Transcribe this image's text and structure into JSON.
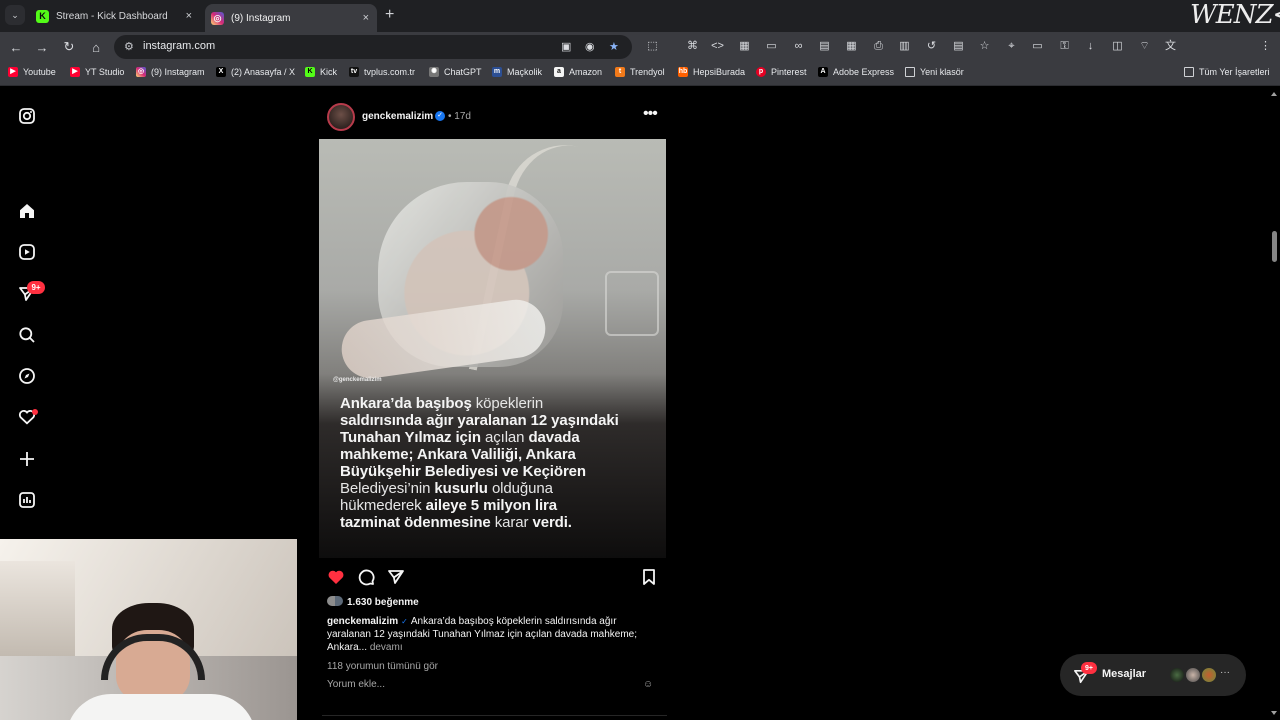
{
  "browser": {
    "tabs": [
      {
        "title": "Stream - Kick Dashboard",
        "icon": "kick-icon",
        "active": false
      },
      {
        "title": "(9) Instagram",
        "icon": "instagram-icon",
        "active": true
      }
    ],
    "tab_close": "×",
    "new_tab": "+",
    "url": "instagram.com",
    "overlay_text": "WENZ<LL",
    "bookmarks": [
      {
        "label": "Youtube",
        "icon": "youtube-icon"
      },
      {
        "label": "YT Studio",
        "icon": "youtube-studio-icon"
      },
      {
        "label": "(9) Instagram",
        "icon": "instagram-icon"
      },
      {
        "label": "(2) Anasayfa / X",
        "icon": "x-icon"
      },
      {
        "label": "Kick",
        "icon": "kick-icon"
      },
      {
        "label": "tvplus.com.tr",
        "icon": "tvplus-icon"
      },
      {
        "label": "ChatGPT",
        "icon": "chatgpt-icon"
      },
      {
        "label": "Maçkolik",
        "icon": "mackolik-icon"
      },
      {
        "label": "Amazon",
        "icon": "amazon-icon"
      },
      {
        "label": "Trendyol",
        "icon": "trendyol-icon"
      },
      {
        "label": "HepsiBurada",
        "icon": "hepsiburada-icon"
      },
      {
        "label": "Pinterest",
        "icon": "pinterest-icon"
      },
      {
        "label": "Adobe Express",
        "icon": "adobe-express-icon"
      },
      {
        "label": "Yeni klasör",
        "icon": "folder-icon"
      }
    ],
    "all_bookmarks": "Tüm Yer İşaretleri"
  },
  "instagram": {
    "sidebar": {
      "notification_badge": "9+"
    },
    "post": {
      "username": "genckemalizim",
      "verified": "✓",
      "separator": "•",
      "age": "17d",
      "more": "•••",
      "media": {
        "watermark": "@genckemalizim",
        "overlay_lines": [
          [
            {
              "text": "Ankara’da başıboş ",
              "style": "bold"
            },
            {
              "text": "köpeklerin",
              "style": "light"
            }
          ],
          [
            {
              "text": "saldırısında ağır yaralanan 12 yaşındaki",
              "style": "bold"
            }
          ],
          [
            {
              "text": "Tunahan Yılmaz için ",
              "style": "bold"
            },
            {
              "text": "açılan ",
              "style": "light"
            },
            {
              "text": "davada",
              "style": "bold"
            }
          ],
          [
            {
              "text": "mahkeme; Ankara Valiliği, Ankara",
              "style": "bold"
            }
          ],
          [
            {
              "text": "Büyükşehir Belediyesi ve Keçiören",
              "style": "bold"
            }
          ],
          [
            {
              "text": "Belediyesi’nin ",
              "style": "light"
            },
            {
              "text": "kusurlu ",
              "style": "bold"
            },
            {
              "text": "olduğuna",
              "style": "light"
            }
          ],
          [
            {
              "text": "hükmederek ",
              "style": "light"
            },
            {
              "text": "aileye 5 milyon lira",
              "style": "bold"
            }
          ],
          [
            {
              "text": "tazminat ödenmesine ",
              "style": "bold"
            },
            {
              "text": "karar ",
              "style": "light"
            },
            {
              "text": "verdi.",
              "style": "bold"
            }
          ]
        ]
      },
      "likes": "1.630 beğenme",
      "caption": "Ankara’da başıboş köpeklerin saldırısında ağır yaralanan 12 yaşındaki Tunahan Yılmaz için açılan davada mahkeme; Ankara...",
      "caption_more": "devamı",
      "view_comments": "118 yorumun tümünü gör",
      "add_comment_placeholder": "Yorum ekle...",
      "emoji": "☺"
    },
    "messages": {
      "label": "Mesajlar",
      "badge": "9+",
      "overflow": "···"
    }
  },
  "colors": {
    "background": "#000000",
    "chrome_toolbar": "#3a3b40",
    "like_red": "#ff3040",
    "verified_blue": "#1877f2",
    "secondary_text": "#a8a8a8"
  }
}
